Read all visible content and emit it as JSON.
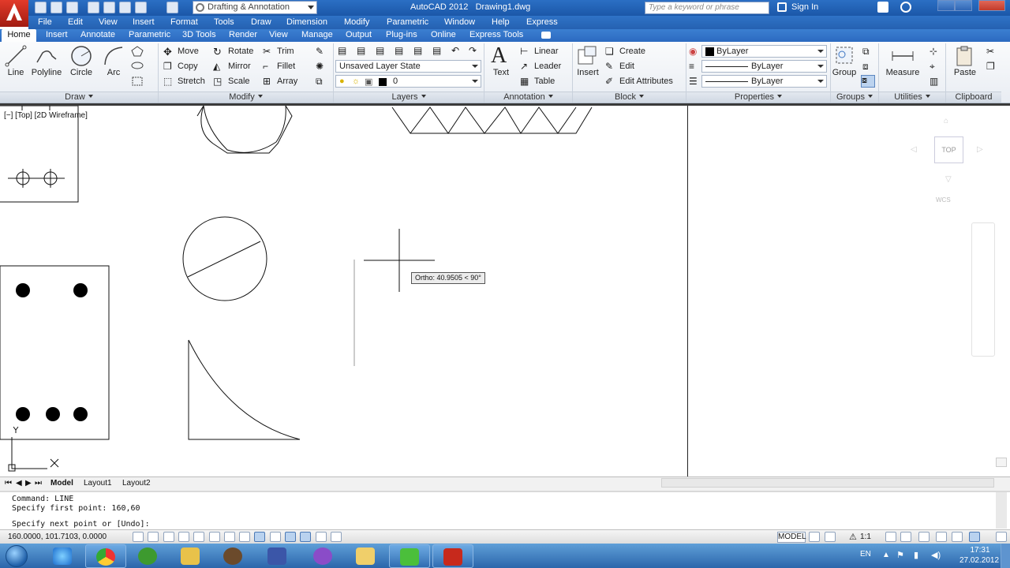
{
  "window": {
    "workspace": "Drafting & Annotation",
    "app_name": "AutoCAD 2012",
    "file_name": "Drawing1.dwg",
    "search_placeholder": "Type a keyword or phrase",
    "sign_in": "Sign In"
  },
  "menu": [
    "File",
    "Edit",
    "View",
    "Insert",
    "Format",
    "Tools",
    "Draw",
    "Dimension",
    "Modify",
    "Parametric",
    "Window",
    "Help",
    "Express"
  ],
  "ribbon_tabs": [
    "Home",
    "Insert",
    "Annotate",
    "Parametric",
    "3D Tools",
    "Render",
    "View",
    "Manage",
    "Output",
    "Plug-ins",
    "Online",
    "Express Tools"
  ],
  "panels": {
    "draw": {
      "title": "Draw",
      "tools": [
        "Line",
        "Polyline",
        "Circle",
        "Arc"
      ]
    },
    "modify": {
      "title": "Modify",
      "tools": [
        "Move",
        "Rotate",
        "Trim",
        "Copy",
        "Mirror",
        "Fillet",
        "Stretch",
        "Scale",
        "Array"
      ]
    },
    "layers": {
      "title": "Layers",
      "layer_state": "Unsaved Layer State",
      "current_layer": "0"
    },
    "annotation": {
      "title": "Annotation",
      "text": "Text",
      "tools": [
        "Linear",
        "Leader",
        "Table"
      ]
    },
    "block": {
      "title": "Block",
      "insert": "Insert",
      "tools": [
        "Create",
        "Edit",
        "Edit Attributes"
      ]
    },
    "properties": {
      "title": "Properties",
      "color": "ByLayer",
      "linetype": "ByLayer",
      "lineweight": "ByLayer"
    },
    "groups": {
      "title": "Groups",
      "group": "Group"
    },
    "utilities": {
      "title": "Utilities",
      "measure": "Measure"
    },
    "clipboard": {
      "title": "Clipboard",
      "paste": "Paste"
    }
  },
  "viewport": {
    "label": "[−] [Top] [2D Wireframe]",
    "ortho_tooltip": "Ortho: 40.9505 < 90°",
    "viewcube_face": "TOP",
    "wcs": "WCS"
  },
  "layout_tabs": [
    "Model",
    "Layout1",
    "Layout2"
  ],
  "command": {
    "history": [
      "Command: LINE",
      "Specify first point: 160,60"
    ],
    "prompt": "Specify next point or [Undo]:"
  },
  "status": {
    "coordinates": "160.0000, 101.7103, 0.0000",
    "model": "MODEL",
    "annotation_scale": "1:1"
  },
  "taskbar": {
    "language": "EN",
    "time": "17:31",
    "date": "27.02.2012"
  }
}
